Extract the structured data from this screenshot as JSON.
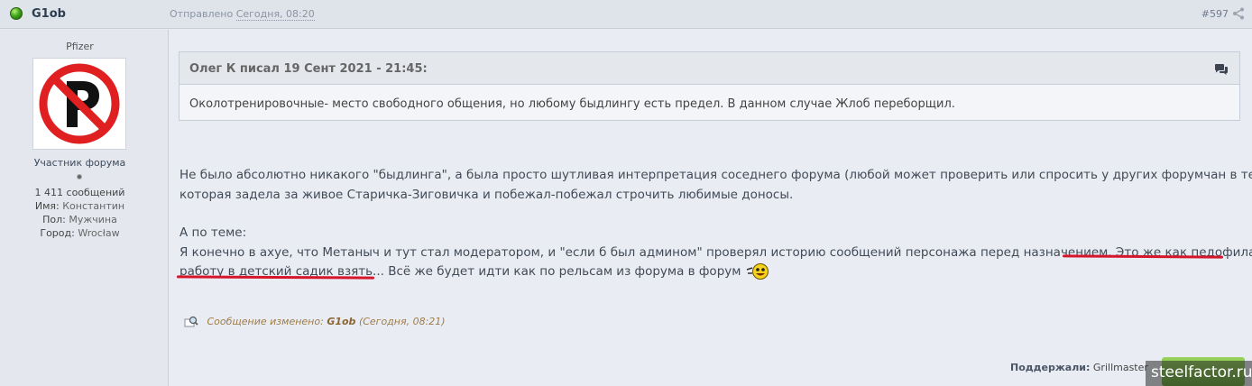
{
  "header": {
    "author": "G1ob",
    "posted_prefix": "Отправлено",
    "posted_date": "Сегодня, 08:20",
    "post_number": "#597"
  },
  "author_panel": {
    "user_title": "Pfizer",
    "group": "Участник форума",
    "posts": "1 411 сообщений",
    "name_label": "Имя:",
    "name_value": "Константин",
    "gender_label": "Пол:",
    "gender_value": "Мужчина",
    "city_label": "Город:",
    "city_value": "Wrocław"
  },
  "quote": {
    "author_line": "Олег К писал 19 Сент 2021 - 21:45:",
    "text": "Околотренировочные- место свободного общения, но любому быдлингу есть предел. В данном случае Жлоб переборщил."
  },
  "body": {
    "line1": "Не было абсолютно никакого \"быдлинга\", а была просто шутливая интерпретация соседнего форума (любой может проверить или спросить у других форумчан в теме),",
    "line2": "которая задела за живое Старичка-Зиговичка и побежал-побежал строчить любимые доносы.",
    "line3": "А по теме:",
    "line4": "Я конечно в ахуе, что Метаныч и тут стал модератором, и \"если б был админом\" проверял историю сообщений персонажа перед назначением. Это же как педофила на",
    "line5": "работу в детский садик взять... Всё же будет идти как по рельсам из форума в форум"
  },
  "edited": {
    "prefix": "Сообщение изменено:",
    "editor": "G1ob",
    "time": "(Сегодня, 08:21)"
  },
  "thanks": {
    "label": "Поддержали:",
    "users": "Grillmaster"
  },
  "watermark": "steelfactor.ru",
  "colors": {
    "underline": "#d6162a",
    "status_online": "#3fa81a"
  },
  "icons": {
    "status": "online-status-icon",
    "share": "share-icon",
    "quote": "quote-bubbles-icon",
    "smiley": "laughing-smiley-icon",
    "edited": "edit-magnifier-icon",
    "avatar": "no-parking-sign"
  }
}
